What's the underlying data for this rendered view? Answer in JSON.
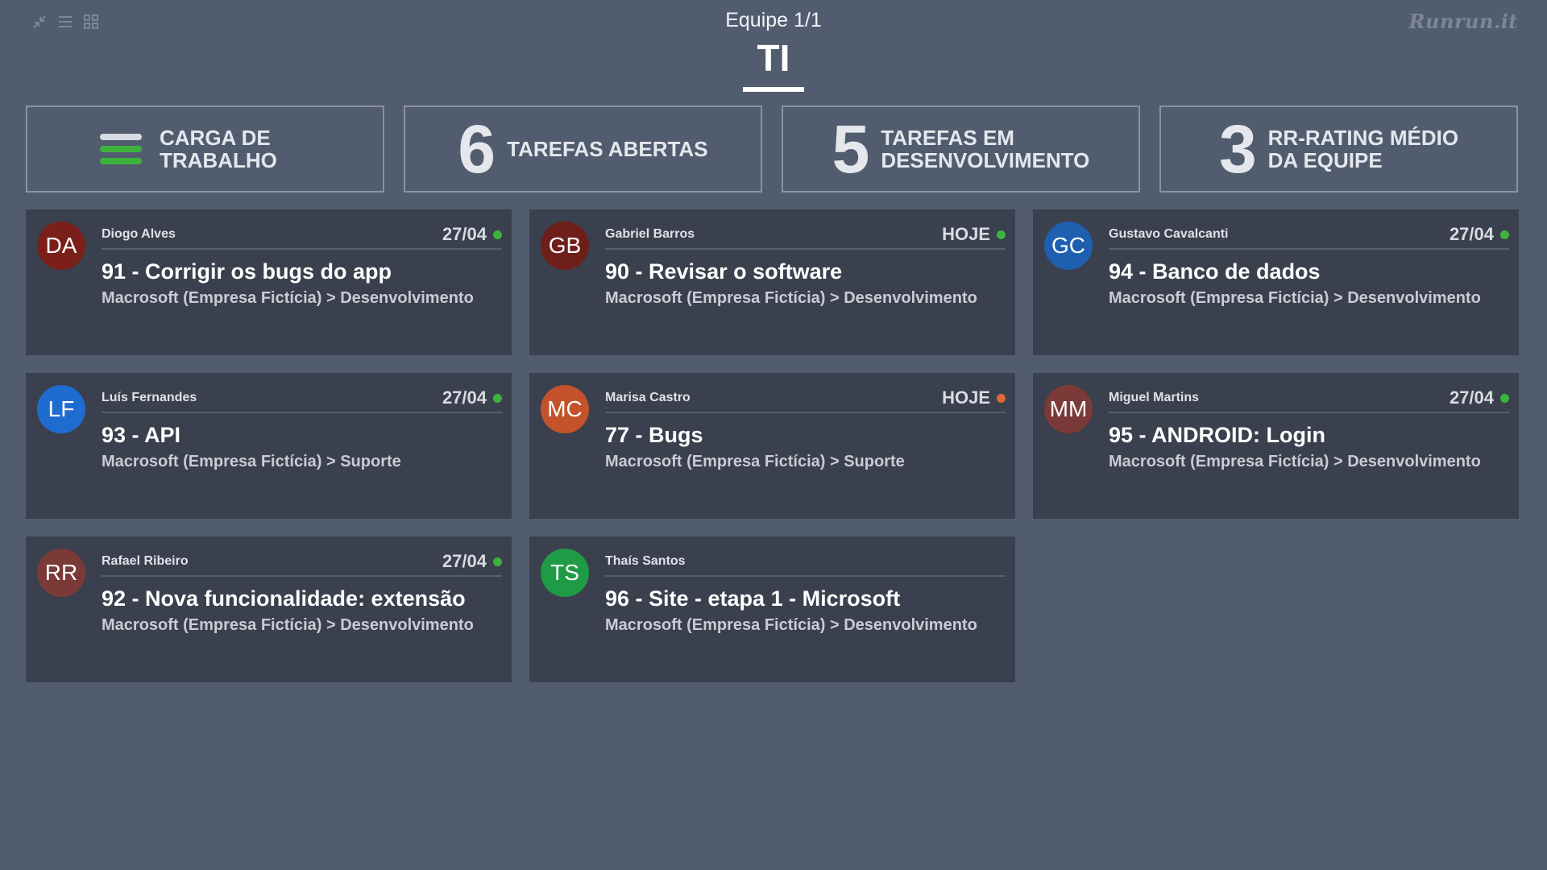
{
  "header": {
    "team_counter": "Equipe 1/1",
    "team_name": "TI",
    "brand": "Runrun.it",
    "view_icons": [
      "collapse-icon",
      "list-view-icon",
      "grid-view-icon"
    ]
  },
  "stats": {
    "workload": {
      "label_line1": "CARGA DE",
      "label_line2": "TRABALHO",
      "icon": "workload-bars-icon"
    },
    "open_tasks": {
      "value": "6",
      "label_line1": "TAREFAS ABERTAS"
    },
    "dev_tasks": {
      "value": "5",
      "label_line1": "TAREFAS EM",
      "label_line2": "DESENVOLVIMENTO"
    },
    "rating": {
      "value": "3",
      "label_line1": "RR-RATING MÉDIO",
      "label_line2": "DA EQUIPE"
    }
  },
  "colors": {
    "on_time": "#3db33d",
    "warning": "#e0683a",
    "card_bg": "#3a404d",
    "page_bg": "#525c6f"
  },
  "cards": [
    {
      "initials": "DA",
      "avatar_color": "#7a1f1a",
      "person": "Diogo Alves",
      "due": "27/04",
      "status_color": "#3db33d",
      "task": "91 - Corrigir os bugs do app",
      "path": "Macrosoft (Empresa Fictícia) > Desenvolvimento"
    },
    {
      "initials": "GB",
      "avatar_color": "#6e1f1a",
      "person": "Gabriel Barros",
      "due": "HOJE",
      "status_color": "#3db33d",
      "task": "90 - Revisar o software",
      "path": "Macrosoft (Empresa Fictícia) > Desenvolvimento"
    },
    {
      "initials": "GC",
      "avatar_color": "#1e5fb0",
      "person": "Gustavo Cavalcanti",
      "due": "27/04",
      "status_color": "#3db33d",
      "task": "94 - Banco de dados",
      "path": "Macrosoft (Empresa Fictícia) > Desenvolvimento"
    },
    {
      "initials": "LF",
      "avatar_color": "#1f6cd1",
      "person": "Luís Fernandes",
      "due": "27/04",
      "status_color": "#3db33d",
      "task": "93 - API",
      "path": "Macrosoft (Empresa Fictícia) > Suporte"
    },
    {
      "initials": "MC",
      "avatar_color": "#c4522a",
      "person": "Marisa Castro",
      "due": "HOJE",
      "status_color": "#e0683a",
      "task": "77 - Bugs",
      "path": "Macrosoft (Empresa Fictícia) > Suporte"
    },
    {
      "initials": "MM",
      "avatar_color": "#7a3a38",
      "person": "Miguel Martins",
      "due": "27/04",
      "status_color": "#3db33d",
      "task": "95 - ANDROID: Login",
      "path": "Macrosoft (Empresa Fictícia) > Desenvolvimento"
    },
    {
      "initials": "RR",
      "avatar_color": "#7a3a38",
      "person": "Rafael Ribeiro",
      "due": "27/04",
      "status_color": "#3db33d",
      "task": "92 - Nova funcionalidade: extensão",
      "path": "Macrosoft (Empresa Fictícia) > Desenvolvimento"
    },
    {
      "initials": "TS",
      "avatar_color": "#1f9a45",
      "person": "Thaís Santos",
      "due": "",
      "status_color": "",
      "task": "96 - Site - etapa 1 - Microsoft",
      "path": "Macrosoft (Empresa Fictícia) > Desenvolvimento"
    }
  ]
}
